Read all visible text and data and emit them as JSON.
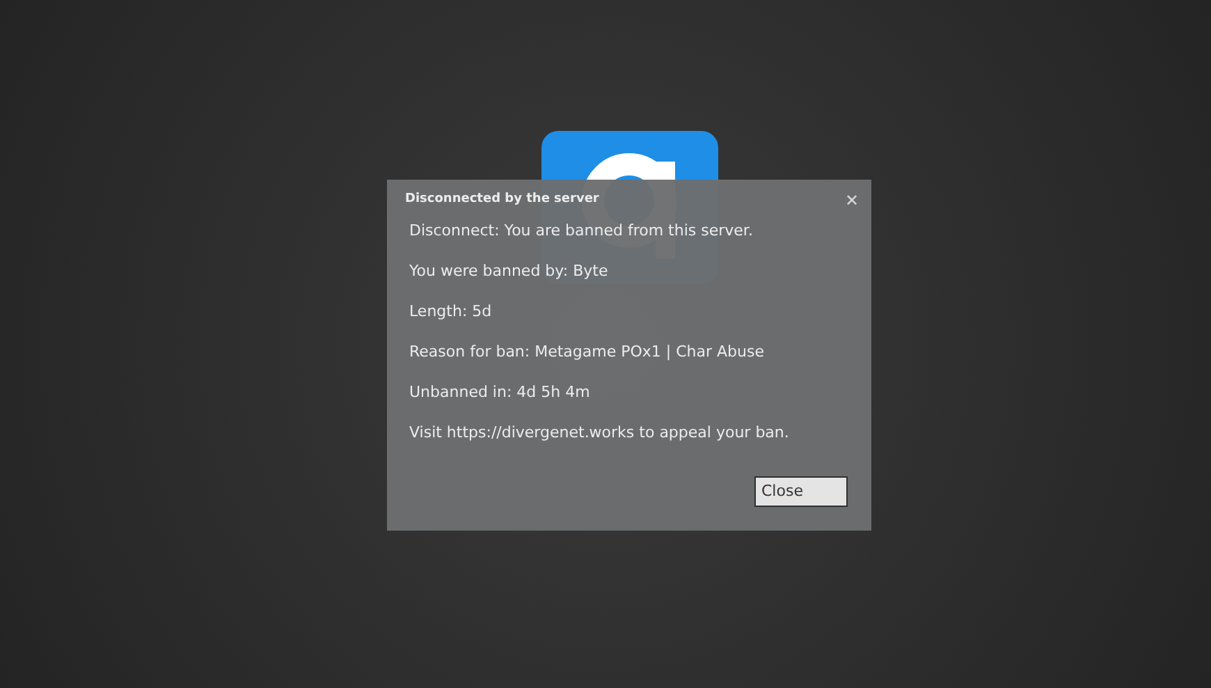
{
  "dialog": {
    "title": "Disconnected by the server",
    "close_glyph": "✕",
    "lines": [
      "Disconnect: You are banned from this server.",
      "You were banned by: Byte",
      "Length: 5d",
      "Reason for ban: Metagame POx1 | Char Abuse",
      "Unbanned in: 4d 5h 4m",
      "Visit https://divergenet.works to appeal your ban."
    ],
    "button": "Close"
  }
}
